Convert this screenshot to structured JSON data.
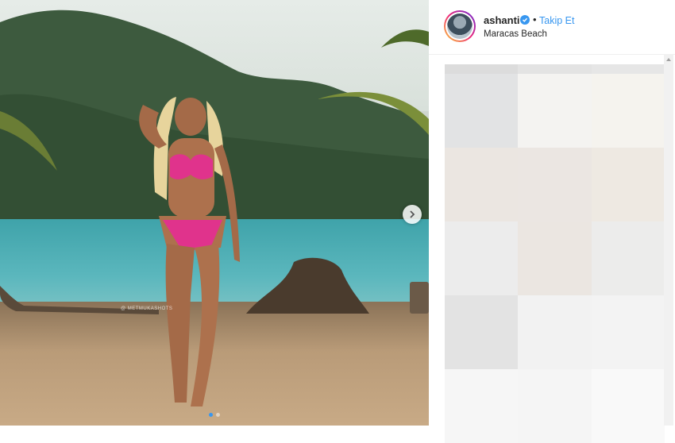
{
  "post": {
    "watermark_text": "@ METMUKASHOTS",
    "carousel": {
      "dot_count": 2,
      "active_index": 0
    }
  },
  "header": {
    "username": "ashanti",
    "separator": "•",
    "follow_label": "Takip Et",
    "location": "Maracas Beach"
  },
  "colors": {
    "accent": "#3897f0",
    "bikini": "#e0338c",
    "sea": "#4aa9b0",
    "sand": "#bfa07a"
  },
  "icons": {
    "next": "chevron-right-icon",
    "verified": "verified-badge-icon",
    "scroll_up": "triangle-up-icon"
  },
  "comments_area": {
    "state": "pixelated",
    "tile_colors": [
      "#e7e7e7",
      "#ececec",
      "#efefef",
      "#e2e3e4",
      "#f4f3f1",
      "#f5f3ee",
      "#ebe6e1",
      "#ebe6e2",
      "#eee9e2",
      "#ececec",
      "#ebe6e1",
      "#ececeb",
      "#e3e3e3",
      "#f2f2f2",
      "#f3f3f3",
      "#f6f6f6",
      "#f5f5f5",
      "#f9f9f9"
    ]
  }
}
